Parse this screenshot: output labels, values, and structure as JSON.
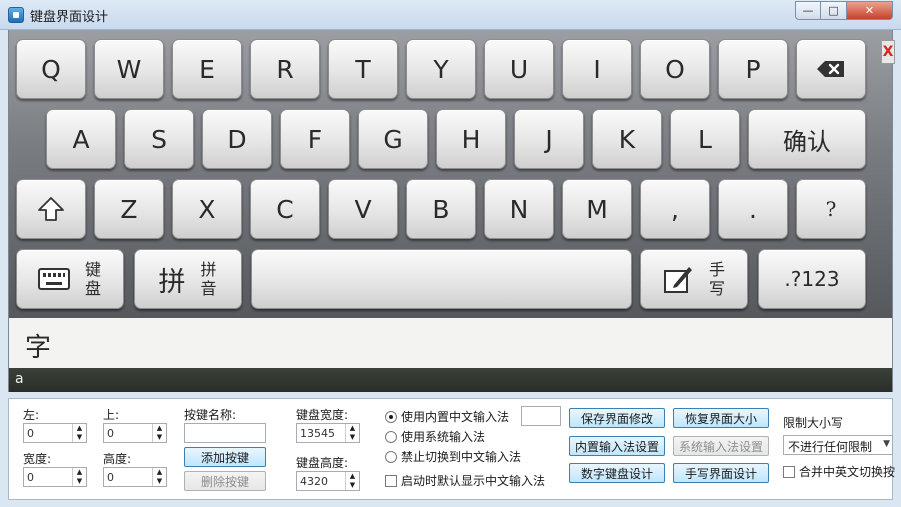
{
  "window": {
    "title": "键盘界面设计",
    "min": "—",
    "max": "□",
    "close": "✕"
  },
  "keyboard": {
    "row1": [
      "Q",
      "W",
      "E",
      "R",
      "T",
      "Y",
      "U",
      "I",
      "O",
      "P"
    ],
    "backspace_icon": "backspace-icon",
    "row2": [
      "A",
      "S",
      "D",
      "F",
      "G",
      "H",
      "J",
      "K",
      "L"
    ],
    "confirm": "确认",
    "row3": [
      "Z",
      "X",
      "C",
      "V",
      "B",
      "N",
      "M",
      ",",
      ".",
      "?"
    ],
    "shift_icon": "shift-up-arrow-icon",
    "keyboard_key": {
      "l1": "键",
      "l2": "盘"
    },
    "pinyin_key": {
      "big": "拼",
      "l1": "拼",
      "l2": "音"
    },
    "handwrite_key": {
      "l1": "手",
      "l2": "写"
    },
    "numbers_key": ".?123",
    "close_mark": "X"
  },
  "candidate": "字",
  "input_line": "a",
  "panel": {
    "left_label": "左:",
    "left_value": "0",
    "top_label": "上:",
    "top_value": "0",
    "width_label": "宽度:",
    "width_value": "0",
    "height_label": "高度:",
    "height_value": "0",
    "keyname_label": "按键名称:",
    "keyname_value": "",
    "add_key": "添加按键",
    "delete_key": "删除按键",
    "kbd_width_label": "键盘宽度:",
    "kbd_width_value": "13545",
    "kbd_height_label": "键盘高度:",
    "kbd_height_value": "4320",
    "radio_builtin": "使用内置中文输入法",
    "radio_system": "使用系统输入法",
    "radio_disable": "禁止切换到中文输入法",
    "check_startup": "启动时默认显示中文输入法",
    "save_ui": "保存界面修改",
    "restore_ui": "恢复界面大小",
    "builtin_settings": "内置输入法设置",
    "system_settings": "系统输入法设置",
    "numeric_design": "数字键盘设计",
    "handwrite_design": "手写界面设计",
    "limit_case_label": "限制大小写",
    "limit_case_value": "不进行任何限制",
    "merge_switch": "合并中英文切换按"
  }
}
